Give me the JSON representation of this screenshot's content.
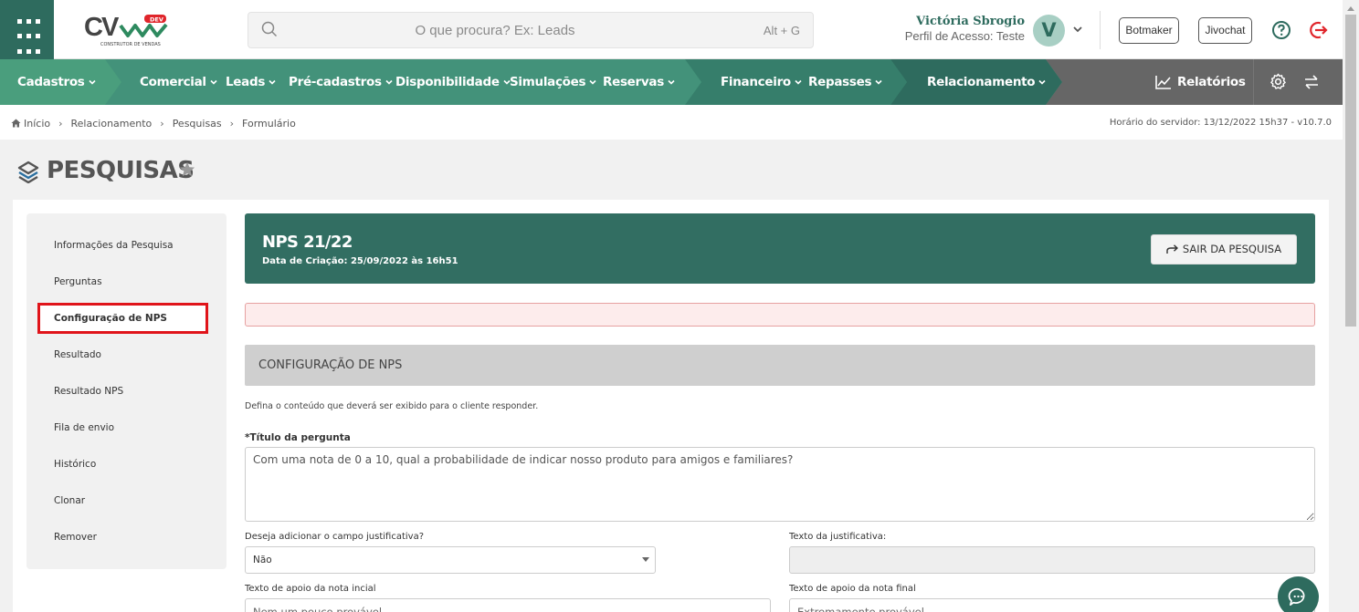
{
  "header": {
    "logo_text": "CV",
    "logo_badge": "DEV",
    "logo_sub": "CONSTRUTOR DE VENDAS",
    "search_placeholder": "O que procura? Ex: Leads",
    "search_hotkey": "Alt + G",
    "user_name": "Victória Sbrogio",
    "user_profile": "Perfil de Acesso: Teste",
    "avatar_letter": "V",
    "botmaker_label": "Botmaker",
    "jivochat_label": "Jivochat"
  },
  "nav": {
    "items": [
      "Cadastros",
      "Comercial",
      "Leads",
      "Pré-cadastros",
      "Disponibilidade",
      "Simulações",
      "Reservas",
      "Financeiro",
      "Repasses",
      "Relacionamento"
    ],
    "reports_label": "Relatórios",
    "colors": {
      "seg1": "#4a9e7d",
      "seg2": "#43927a",
      "seg3": "#367e6b",
      "seg4": "#2e6b5e",
      "right": "#666666"
    }
  },
  "breadcrumb": {
    "items": [
      "Início",
      "Relacionamento",
      "Pesquisas",
      "Formulário"
    ],
    "server_time": "Horário do servidor: 13/12/2022 15h37 - v10.7.0"
  },
  "page": {
    "title": "PESQUISAS"
  },
  "sidebar": {
    "items": [
      "Informações da Pesquisa",
      "Perguntas",
      "Configuração de NPS",
      "Resultado",
      "Resultado NPS",
      "Fila de envio",
      "Histórico",
      "Clonar",
      "Remover"
    ],
    "active_index": 2
  },
  "survey": {
    "title": "NPS 21/22",
    "created": "Data de Criação: 25/09/2022 às 16h51",
    "exit_label": "SAIR DA PESQUISA"
  },
  "form": {
    "section_title": "CONFIGURAÇÃO DE NPS",
    "hint": "Defina o conteúdo que deverá ser exibido para o cliente responder.",
    "question_label": "*Título da pergunta",
    "question_value": "Com uma nota de 0 a 10, qual a probabilidade de indicar nosso produto para amigos e familiares?",
    "justification_label": "Deseja adicionar o campo justificativa?",
    "justification_value": "Não",
    "justification_text_label": "Texto da justificativa:",
    "start_label": "Texto de apoio da nota incial",
    "start_value": "Nem um pouco provável",
    "end_label": "Texto de apoio da nota final",
    "end_value": "Extremamente provável"
  }
}
